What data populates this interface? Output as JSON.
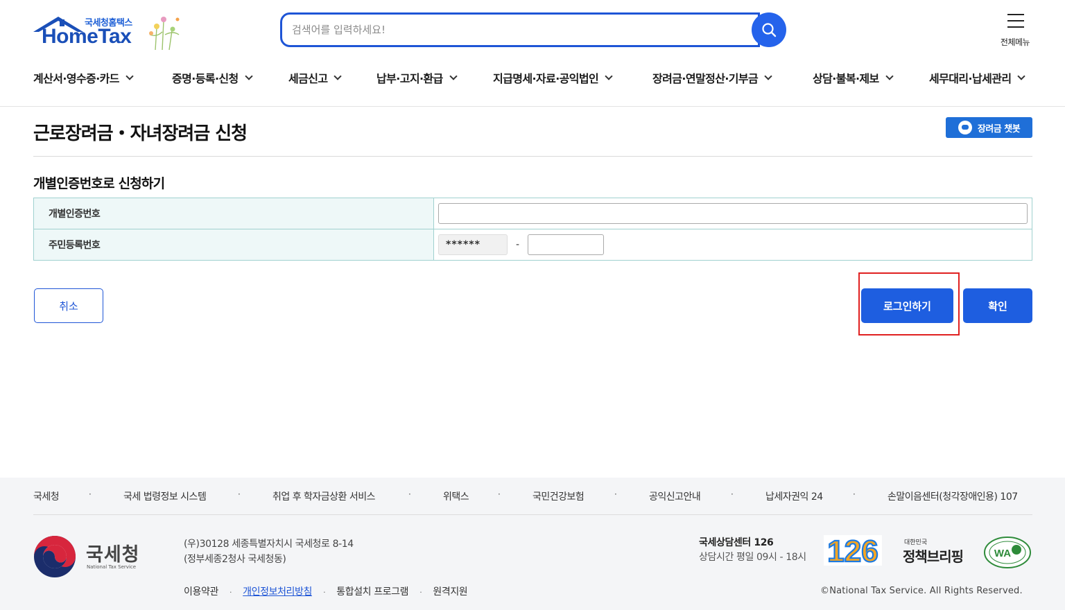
{
  "header": {
    "logo_sub": "국세청홈택스",
    "logo_main": "HomeTax",
    "search_placeholder": "검색어를 입력하세요!",
    "all_menu_label": "전체메뉴"
  },
  "gnb": [
    {
      "label": "계산서·영수증·카드"
    },
    {
      "label": "증명·등록·신청"
    },
    {
      "label": "세금신고"
    },
    {
      "label": "납부·고지·환급"
    },
    {
      "label": "지급명세·자료·공익법인"
    },
    {
      "label": "장려금·연말정산·기부금"
    },
    {
      "label": "상담·불복·제보"
    },
    {
      "label": "세무대리·납세관리"
    }
  ],
  "page": {
    "title": "근로장려금・자녀장려금 신청",
    "chatbot_label": "장려금 챗봇",
    "section_title": "개별인증번호로 신청하기"
  },
  "form": {
    "auth_label": "개별인증번호",
    "rrn_label": "주민등록번호",
    "rrn_masked": "******",
    "rrn_dash": "-"
  },
  "buttons": {
    "cancel": "취소",
    "login": "로그인하기",
    "confirm": "확인"
  },
  "footer": {
    "links": [
      "국세청",
      "국세 법령정보 시스템",
      "취업 후 학자금상환 서비스",
      "위택스",
      "국민건강보험",
      "공익신고안내",
      "납세자권익 24",
      "손말이음센터(청각장애인용) 107"
    ],
    "separator": "·",
    "agency_name": "국세청",
    "agency_en": "National Tax Service",
    "address_line1": "(우)30128 세종특별자치시 국세청로 8-14",
    "address_line2": "(정부세종2청사 국세청동)",
    "bottom_links": {
      "terms": "이용약관",
      "privacy": "개인정보처리방침",
      "install": "통합설치 프로그램",
      "remote": "원격지원"
    },
    "center_title": "국세상담센터 126",
    "center_hours": "상담시간 평일 09시 - 18시",
    "badge_126": "126",
    "policy_small": "대한민국",
    "policy_main": "정책브리핑",
    "copyright": "©National Tax Service. All Rights Reserved."
  },
  "colors": {
    "primary": "#1e5ee0",
    "brand_blue": "#1a4fb8",
    "highlight_red": "#e02020",
    "table_border": "#9fd1cf",
    "table_header_bg": "#eef8f8",
    "footer_bg": "#f4f5f7"
  }
}
